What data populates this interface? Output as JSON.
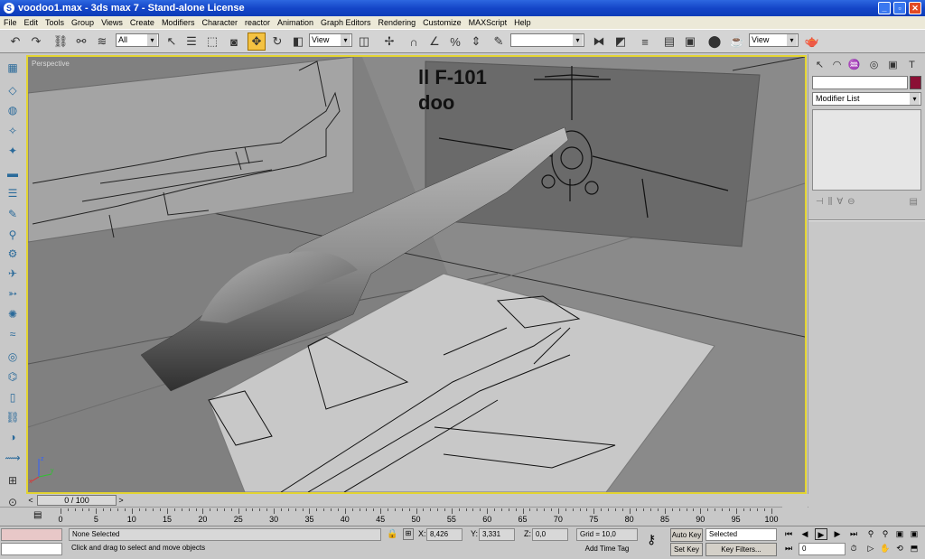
{
  "window": {
    "title": "voodoo1.max - 3ds max 7 - Stand-alone License",
    "minimize": "_",
    "maximize": "▫",
    "close": "✕"
  },
  "menu": [
    "File",
    "Edit",
    "Tools",
    "Group",
    "Views",
    "Create",
    "Modifiers",
    "Character",
    "reactor",
    "Animation",
    "Graph Editors",
    "Rendering",
    "Customize",
    "MAXScript",
    "Help"
  ],
  "toolbar": {
    "selection_filter": "All",
    "reference_coord": "View",
    "named_selection": "",
    "render_view": "View"
  },
  "viewport": {
    "label": "Perspective",
    "backdrop_text_line1": "ll F-101",
    "backdrop_text_line2": "doo"
  },
  "command_panel": {
    "object_name": "",
    "object_color": "#8b1035",
    "modifier_list": "Modifier List"
  },
  "time_slider": {
    "frame_display": "0 / 100",
    "prev": "<",
    "next": ">"
  },
  "trackbar": {
    "ticks": [
      0,
      5,
      10,
      15,
      20,
      25,
      30,
      35,
      40,
      45,
      50,
      55,
      60,
      65,
      70,
      75,
      80,
      85,
      90,
      95,
      100
    ]
  },
  "status": {
    "selection": "None Selected",
    "prompt": "Click and drag to select and move objects",
    "x_label": "X:",
    "x_value": "8,426",
    "y_label": "Y:",
    "y_value": "3,331",
    "z_label": "Z:",
    "z_value": "0,0",
    "grid": "Grid = 10,0",
    "add_time_tag": "Add Time Tag",
    "auto_key": "Auto Key",
    "set_key": "Set Key",
    "key_mode": "Selected",
    "key_filters": "Key Filters...",
    "current_frame": "0"
  }
}
